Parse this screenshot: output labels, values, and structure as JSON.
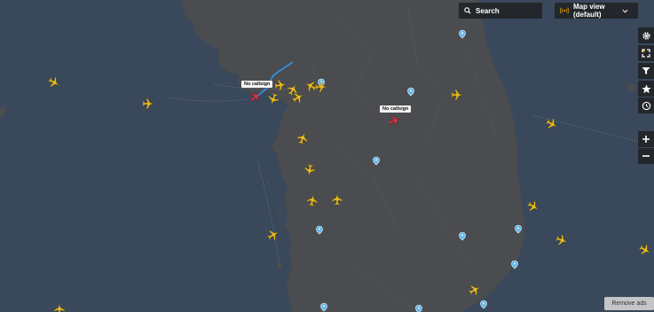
{
  "search": {
    "label": "Search"
  },
  "map_view": {
    "label": "Map view (default)"
  },
  "callsigns": [
    "No callsign",
    "No callsign"
  ],
  "remove_ads": {
    "label": "Remove ads"
  },
  "colors": {
    "sea": "#39485a",
    "land": "#4a4c4f",
    "plane": "#f2c21b",
    "selected_plane": "#e3344a",
    "panel": "#23272c",
    "track": "#2f8fe0"
  },
  "icons": {
    "settings": "gear-icon",
    "fullscreen": "fullscreen-icon",
    "filter": "filter-icon",
    "favorites": "star-icon",
    "playback": "playback-icon",
    "zoom_in": "plus-icon",
    "zoom_out": "minus-icon",
    "search": "search-icon",
    "broadcast": "broadcast-icon"
  }
}
